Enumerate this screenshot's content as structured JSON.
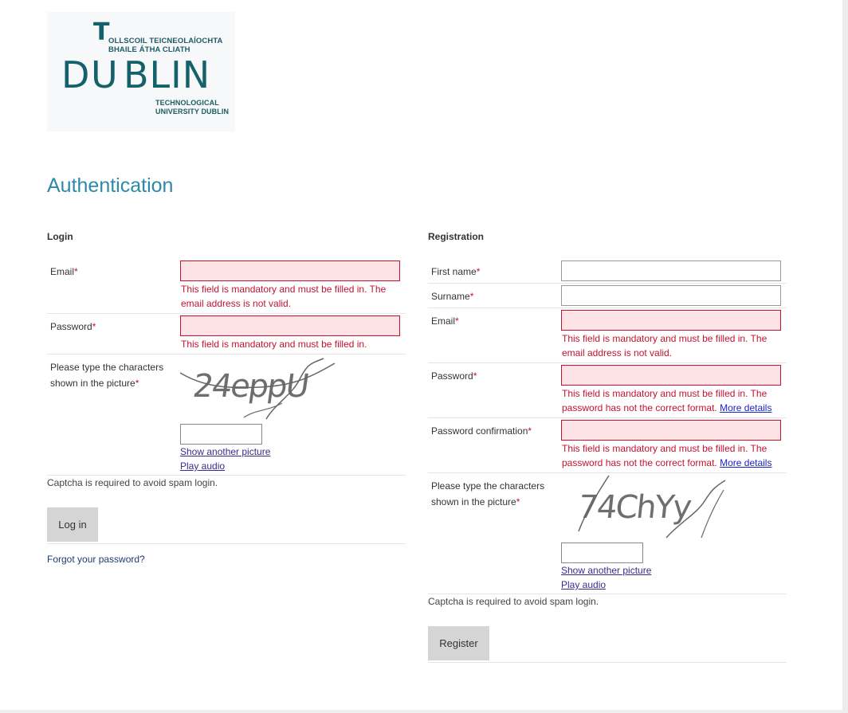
{
  "logo": {
    "line1": "OLLSCOIL TEICNEOLAÍOCHTA",
    "line2": "BHAILE ÁTHA CLIATH",
    "big_d": "D",
    "big_u": "U",
    "big_rest": "BLIN",
    "big_t": "T",
    "line3": "TECHNOLOGICAL",
    "line4": "UNIVERSITY DUBLIN",
    "brand_color": "#15616b"
  },
  "page_title": "Authentication",
  "login": {
    "title": "Login",
    "email_label": "Email",
    "email_error": "This field is mandatory and must be filled in. The email address is not valid.",
    "password_label": "Password",
    "password_error": "This field is mandatory and must be filled in.",
    "captcha_label": "Please type the characters shown in the picture",
    "captcha_text": "24eppU",
    "show_another": "Show another picture",
    "play_audio": "Play audio",
    "captcha_note": "Captcha is required to avoid spam login.",
    "button": "Log in",
    "forgot": "Forgot your password?"
  },
  "registration": {
    "title": "Registration",
    "first_name_label": "First name",
    "surname_label": "Surname",
    "email_label": "Email",
    "email_error": "This field is mandatory and must be filled in. The email address is not valid.",
    "password_label": "Password",
    "password_error": "This field is mandatory and must be filled in. The password has not the correct format.",
    "password_more": "More details",
    "confirm_label": "Password confirmation",
    "confirm_error": "This field is mandatory and must be filled in. The password has not the correct format.",
    "confirm_more": "More details",
    "captcha_label": "Please type the characters shown in the picture",
    "captcha_text": "74ChYy",
    "show_another": "Show another picture",
    "play_audio": "Play audio",
    "captcha_note": "Captcha is required to avoid spam login.",
    "button": "Register"
  },
  "required_marker": "*",
  "colors": {
    "title": "#2c8aa8",
    "error": "#c4122f",
    "error_bg": "#fde3e5",
    "button_bg": "#d5d5d5"
  }
}
